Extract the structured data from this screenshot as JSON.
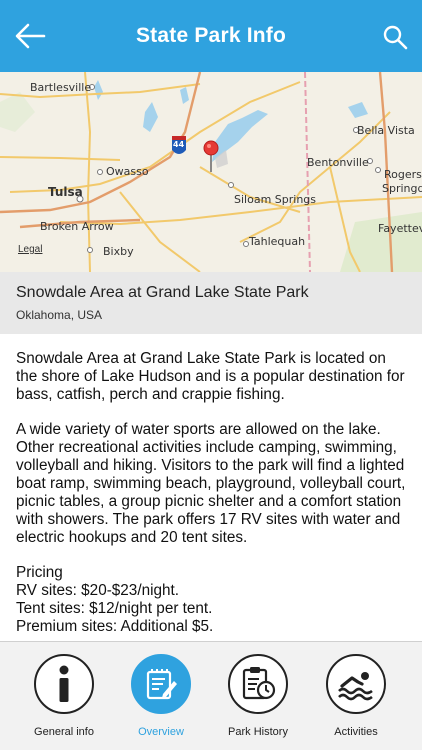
{
  "header": {
    "title": "State Park Info",
    "back_icon": "arrow-left-icon",
    "search_icon": "search-icon"
  },
  "map": {
    "cities": [
      "Bartlesville",
      "Owasso",
      "Tulsa",
      "Broken Arrow",
      "Bixby",
      "Siloam Springs",
      "Tahlequah",
      "Bentonville",
      "Bella Vista",
      "Rogers",
      "Springd",
      "Fayettev"
    ],
    "interstate": "44",
    "legal": "Legal",
    "marker_icon": "map-pin-icon"
  },
  "park": {
    "name": "Snowdale Area at Grand Lake State Park",
    "location": "Oklahoma, USA"
  },
  "description": {
    "p1": "Snowdale Area at Grand Lake State Park is located on the shore of Lake Hudson and is a popular destination for bass, catfish, perch and crappie fishing.",
    "p2": "A wide variety of water sports are allowed on the lake. Other recreational activities include camping, swimming, volleyball and hiking. Visitors to the park will find a lighted boat ramp, swimming beach, playground, volleyball court, picnic tables, a group picnic shelter and a comfort station with showers. The park offers 17 RV sites with water and electric hookups and 20 tent sites.",
    "pricing_title": "Pricing",
    "pricing_rv": "RV sites: $20-$23/night.",
    "pricing_tent": "Tent sites: $12/night per tent.",
    "pricing_premium": "Premium sites: Additional $5."
  },
  "tabs": [
    {
      "label": "General info",
      "icon": "info-icon",
      "active": false
    },
    {
      "label": "Overview",
      "icon": "document-edit-icon",
      "active": true
    },
    {
      "label": "Park History",
      "icon": "history-clipboard-icon",
      "active": false
    },
    {
      "label": "Activities",
      "icon": "swimmer-icon",
      "active": false
    }
  ],
  "colors": {
    "accent": "#2fa2df",
    "map_bg": "#f3f0e6",
    "water": "#a5d2ec",
    "info_bg": "#e8e8e8"
  }
}
